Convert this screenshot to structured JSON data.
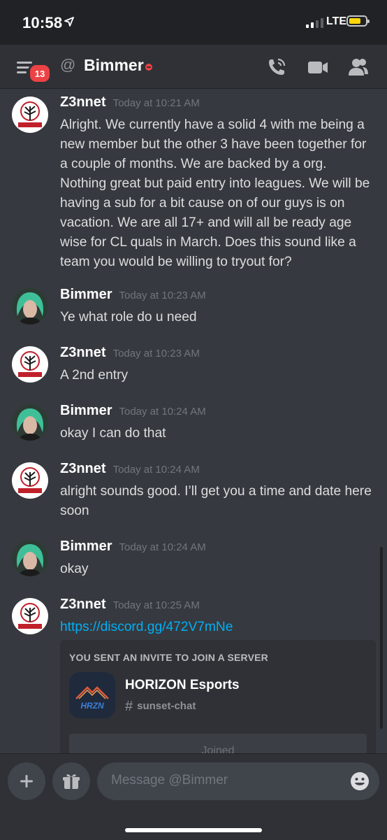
{
  "status_bar": {
    "time": "10:58",
    "network": "LTE",
    "colors": {
      "battery": "#ffd60a"
    }
  },
  "header": {
    "badge_count": "13",
    "channel_name": "Bimmer",
    "icons": [
      "menu-icon",
      "at-icon",
      "dnd-status-icon",
      "call-icon",
      "video-icon",
      "members-icon"
    ]
  },
  "messages": [
    {
      "author": "Z3nnet",
      "timestamp": "Today at 10:21 AM",
      "text": "Alright. We currently have a solid 4 with me being a new member but the other 3 have been together for a couple of months. We are backed by a org. Nothing great but paid entry into leagues. We will be having a sub for a bit cause on of our guys is on vacation. We are all 17+ and will all be ready age wise for CL quals in March. Does this sound like a team you would be willing to tryout for?"
    },
    {
      "author": "Bimmer",
      "timestamp": "Today at 10:23 AM",
      "text": "Ye what role do u need"
    },
    {
      "author": "Z3nnet",
      "timestamp": "Today at 10:23 AM",
      "text": "A 2nd entry"
    },
    {
      "author": "Bimmer",
      "timestamp": "Today at 10:24 AM",
      "text": "okay I can do that"
    },
    {
      "author": "Z3nnet",
      "timestamp": "Today at 10:24 AM",
      "text": "alright sounds good. I’ll get you a time and date here soon"
    },
    {
      "author": "Bimmer",
      "timestamp": "Today at 10:24 AM",
      "text": "okay"
    },
    {
      "author": "Z3nnet",
      "timestamp": "Today at 10:25 AM",
      "text": "https://discord.gg/472V7mNe"
    }
  ],
  "invite": {
    "title": "YOU SENT AN INVITE TO JOIN A SERVER",
    "server_name": "HORIZON Esports",
    "channel": "sunset-chat",
    "button_label": "Joined",
    "server_icon_text": "HRZN"
  },
  "input": {
    "placeholder": "Message @Bimmer",
    "icons": [
      "plus-icon",
      "gift-icon",
      "emoji-icon"
    ]
  },
  "colors": {
    "background": "#36393f",
    "header": "#2f3136",
    "link": "#00aff4",
    "badge": "#ed4245"
  }
}
